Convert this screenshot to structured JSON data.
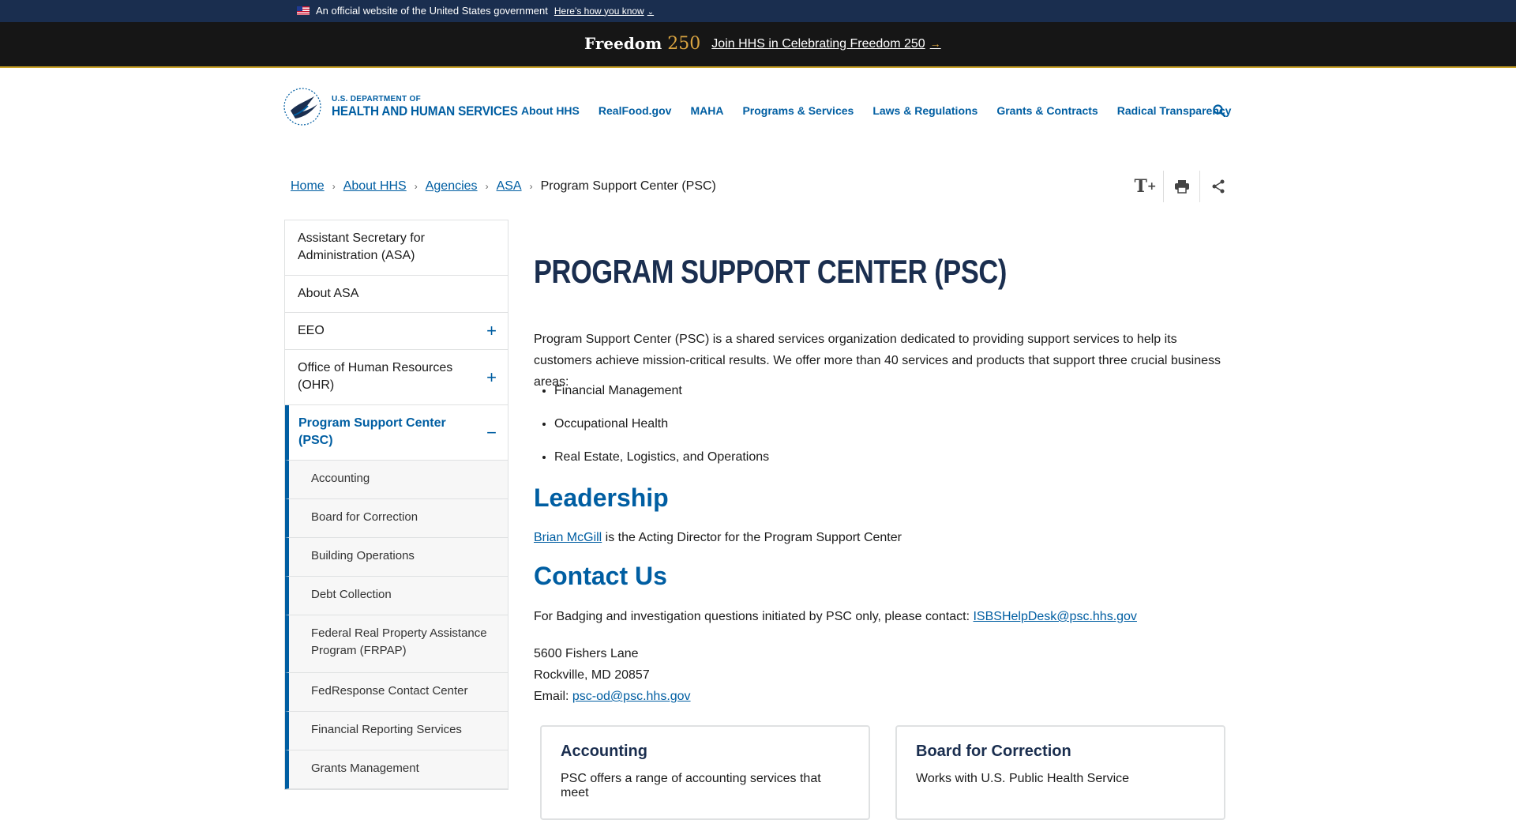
{
  "gov_banner": {
    "text": "An official website of the United States government",
    "link": "Here’s how you know"
  },
  "freedom": {
    "logo_word": "Freedom",
    "logo_number": "250",
    "link": "Join HHS in Celebrating Freedom 250"
  },
  "header": {
    "logo_small": "U.S. DEPARTMENT OF",
    "logo_big": "HEALTH AND HUMAN SERVICES",
    "nav": [
      "About HHS",
      "RealFood.gov",
      "MAHA",
      "Programs & Services",
      "Laws & Regulations",
      "Grants & Contracts",
      "Radical Transparency"
    ]
  },
  "breadcrumb": {
    "items": [
      "Home",
      "About HHS",
      "Agencies",
      "ASA"
    ],
    "current": "Program Support Center (PSC)"
  },
  "sidebar": {
    "items": [
      {
        "label": "Assistant Secretary for Administration (ASA)"
      },
      {
        "label": "About ASA"
      },
      {
        "label": "EEO"
      },
      {
        "label": "Office of Human Resources (OHR)"
      },
      {
        "label": "Program Support Center (PSC)"
      }
    ],
    "subitems": [
      "Accounting",
      "Board for Correction",
      "Building Operations",
      "Debt Collection",
      "Federal Real Property Assistance Program (FRPAP)",
      "FedResponse Contact Center",
      "Financial Reporting Services",
      "Grants Management"
    ]
  },
  "main": {
    "title": "Program Support Center (PSC)",
    "intro": "Program Support Center (PSC) is a shared services organization dedicated to providing support services to help its customers achieve mission-critical results. We offer more than 40 services and products that support three crucial business areas:",
    "bullets": [
      "Financial Management",
      "Occupational Health",
      "Real Estate, Logistics, and Operations"
    ],
    "leadership_heading": "Leadership",
    "leadership_name": "Brian McGill",
    "leadership_text": " is the Acting Director for the Program Support Center",
    "contact_heading": "Contact Us",
    "contact_text": "For Badging and investigation questions initiated by PSC only, please contact: ",
    "contact_email": "ISBSHelpDesk@psc.hhs.gov",
    "address_line1": "5600 Fishers Lane",
    "address_line2": "Rockville, MD 20857",
    "email_label": "Email: ",
    "email": "psc-od@psc.hhs.gov",
    "cards": [
      {
        "title": "Accounting",
        "text": "PSC offers a range of accounting services that meet"
      },
      {
        "title": "Board for Correction",
        "text": "Works with U.S. Public Health Service"
      }
    ]
  }
}
